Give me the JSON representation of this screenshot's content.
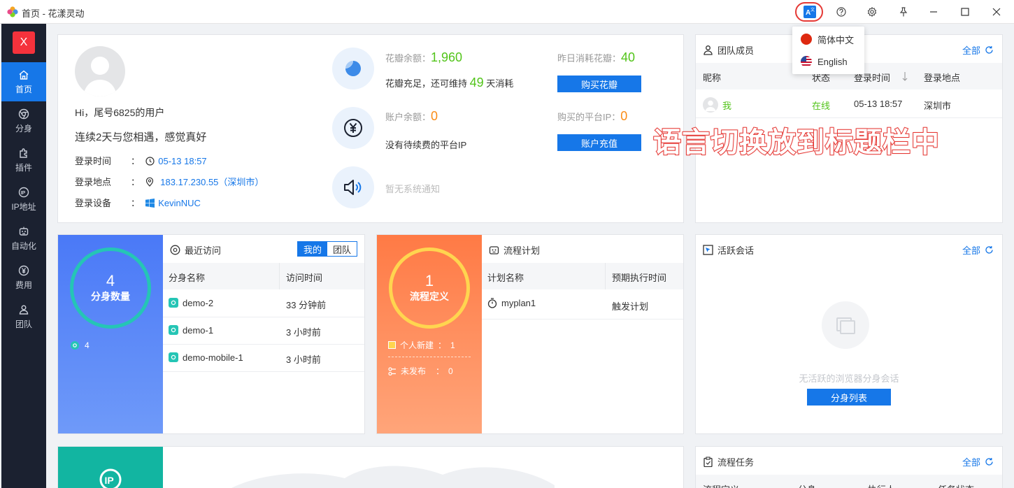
{
  "window": {
    "title": "首页 - 花漾灵动"
  },
  "sidebar": {
    "top_badge": "X",
    "items": [
      {
        "label": "首页",
        "icon": "home-icon",
        "active": true
      },
      {
        "label": "分身",
        "icon": "chrome-icon",
        "active": false
      },
      {
        "label": "插件",
        "icon": "puzzle-icon",
        "active": false
      },
      {
        "label": "IP地址",
        "icon": "ip-icon",
        "active": false
      },
      {
        "label": "自动化",
        "icon": "robot-icon",
        "active": false
      },
      {
        "label": "费用",
        "icon": "yen-icon",
        "active": false
      },
      {
        "label": "团队",
        "icon": "team-icon",
        "active": false
      }
    ]
  },
  "profile": {
    "greeting": "Hi，尾号6825的用户",
    "subgreeting": "连续2天与您相遇，感觉真好",
    "login_time_label": "登录时间",
    "login_time": "05-13 18:57",
    "login_place_label": "登录地点",
    "login_place": "183.17.230.55（深圳市）",
    "login_device_label": "登录设备",
    "login_device": "KevinNUC",
    "colon": "："
  },
  "stats": {
    "petal_balance_label": "花瓣余额：",
    "petal_balance": "1,960",
    "petal_status_pre": "花瓣充足，还可维持",
    "petal_days": "49",
    "petal_status_post": "天消耗",
    "yesterday_label": "昨日消耗花瓣：",
    "yesterday": "40",
    "buy_petals": "购买花瓣",
    "account_balance_label": "账户余额：",
    "account_balance": "0",
    "renew_text": "没有待续费的平台IP",
    "bought_ip_label": "购买的平台IP：",
    "bought_ip": "0",
    "recharge": "账户充值",
    "notice": "暂无系统通知"
  },
  "team": {
    "title": "团队成员",
    "all": "全部",
    "columns": [
      "昵称",
      "状态",
      "登录时间",
      "登录地点"
    ],
    "rows": [
      {
        "nick": "我",
        "status": "在线",
        "time": "05-13 18:57",
        "place": "深圳市"
      }
    ]
  },
  "language_menu": {
    "items": [
      "简体中文",
      "English"
    ]
  },
  "annotation": "语言切换放到标题栏中",
  "profiles": {
    "count": "4",
    "count_label": "分身数量",
    "small_count": "4",
    "recent_title": "最近访问",
    "seg_mine": "我的",
    "seg_team": "团队",
    "columns": [
      "分身名称",
      "访问时间"
    ],
    "rows": [
      {
        "name": "demo-2",
        "time": "33 分钟前"
      },
      {
        "name": "demo-1",
        "time": "3 小时前"
      },
      {
        "name": "demo-mobile-1",
        "time": "3 小时前"
      }
    ]
  },
  "flow": {
    "count": "1",
    "count_label": "流程定义",
    "personal_label": "个人新建",
    "personal_value": "1",
    "unpublished_label": "未发布",
    "unpublished_value": "0",
    "sep": "：",
    "plan_title": "流程计划",
    "columns": [
      "计划名称",
      "预期执行时间"
    ],
    "rows": [
      {
        "name": "myplan1",
        "time": "触发计划"
      }
    ]
  },
  "sessions": {
    "title": "活跃会话",
    "all": "全部",
    "empty": "无活跃的浏览器分身会话",
    "button": "分身列表"
  },
  "tasks": {
    "title": "流程任务",
    "all": "全部",
    "columns": [
      "流程定义",
      "分身",
      "执行人",
      "任务状态"
    ]
  },
  "colors": {
    "primary": "#1677e8",
    "sidebar_bg": "#1b2130",
    "green": "#52c41a",
    "orange": "#fa8c16",
    "annotation_red": "#e53935"
  }
}
